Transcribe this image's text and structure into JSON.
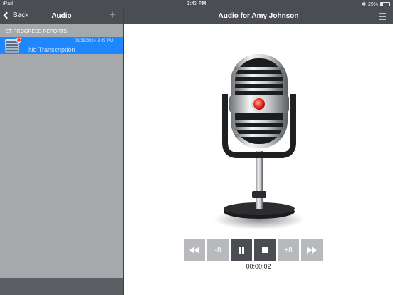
{
  "status_bar": {
    "carrier": "iPad",
    "time": "3:43 PM",
    "battery": "29%"
  },
  "left_pane": {
    "back_label": "Back",
    "title": "Audio",
    "add_icon": "plus-icon",
    "section_header": "ET PROGRESS REPORTS",
    "items": [
      {
        "date": "08/29/2014 3:43 PM",
        "label": "No Transcription",
        "selected": true
      }
    ]
  },
  "right_pane": {
    "title": "Audio for Amy Johnson",
    "menu_icon": "menu-icon",
    "microphone_icon": "microphone-icon"
  },
  "controls": {
    "rewind_icon": "rewind-icon",
    "back8": "-8",
    "pause_icon": "pause-icon",
    "stop_icon": "stop-icon",
    "forward8": "+8",
    "fast_forward_icon": "fast-forward-icon",
    "elapsed": "00:00:02"
  },
  "colors": {
    "nav": "#4a4d51",
    "selection": "#1e87ff",
    "sidebar": "#a6a9ac",
    "recording": "#ff3b30"
  }
}
